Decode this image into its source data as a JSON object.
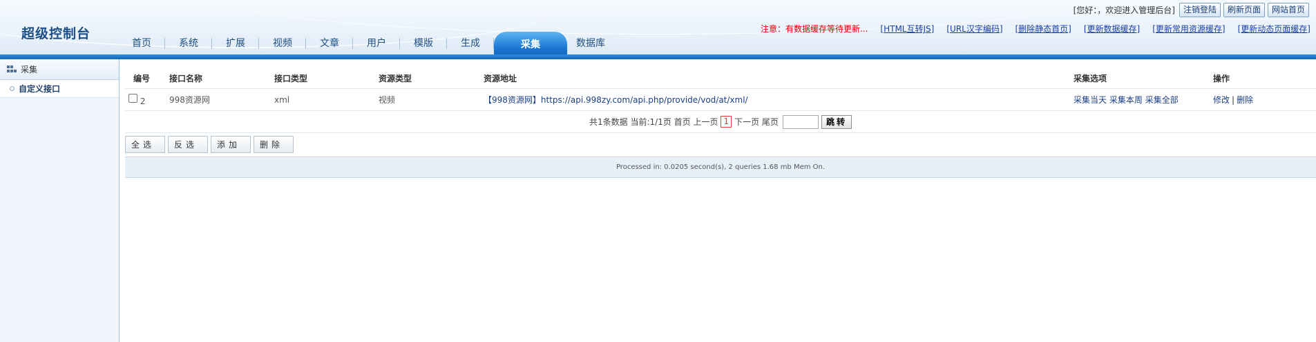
{
  "header": {
    "brand": "超级控制台",
    "greeting": "[您好：，欢迎进入管理后台]",
    "buttons": {
      "logout": "注销登陆",
      "refresh": "刷新页面",
      "home": "网站首页"
    },
    "notice": "注意：有数据缓存等待更新...",
    "links": [
      "[HTML互转JS]",
      "[URL汉字编码]",
      "[删除静态首页]",
      "[更新数据缓存]",
      "[更新常用资源缓存]",
      "[更新动态页面缓存]"
    ]
  },
  "nav": {
    "tabs": [
      "首页",
      "系统",
      "扩展",
      "视频",
      "文章",
      "用户",
      "模版",
      "生成",
      "采集",
      "数据库"
    ],
    "active": "采集"
  },
  "sidebar": {
    "title": "采集",
    "items": [
      "自定义接口"
    ]
  },
  "table": {
    "headers": [
      "编号",
      "接口名称",
      "接口类型",
      "资源类型",
      "资源地址",
      "采集选项",
      "操作"
    ],
    "rows": [
      {
        "id": "2",
        "name": "998资源网",
        "type": "xml",
        "resource_type": "视频",
        "url": "【998资源网】https://api.998zy.com/api.php/provide/vod/at/xml/",
        "collect_options": [
          "采集当天",
          "采集本周",
          "采集全部"
        ],
        "ops": [
          "修改",
          "删除"
        ],
        "op_sep": "|"
      }
    ]
  },
  "pager": {
    "summary": "共1条数据 当前:1/1页 首页 上一页",
    "current": "1",
    "after": "下一页 尾页",
    "goto_label": "跳转",
    "goto_value": ""
  },
  "actions": [
    "全选",
    "反选",
    "添加",
    "删除"
  ],
  "footer": "Processed in: 0.0205 second(s), 2 queries 1.68 mb Mem On."
}
